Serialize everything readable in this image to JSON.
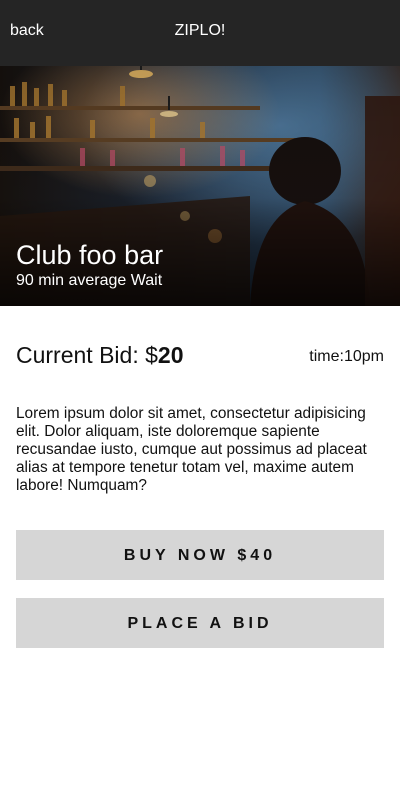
{
  "header": {
    "back_label": "back",
    "title": "ZIPLO!"
  },
  "venue": {
    "name": "Club foo bar",
    "wait": "90 min average Wait",
    "image": "bar-interior-photo"
  },
  "bid": {
    "label_prefix": "Current Bid: $",
    "amount": "20",
    "time": "time:10pm"
  },
  "description": "Lorem ipsum dolor sit amet, consectetur adipisicing elit. Dolor aliquam, iste doloremque sapiente recusandae iusto, cumque aut possimus ad placeat alias at tempore tenetur totam vel, maxime autem labore! Numquam?",
  "actions": {
    "buy_now_label": "BUY NOW $40",
    "place_bid_label": "PLACE A BID"
  },
  "colors": {
    "header_bg": "#252525",
    "button_bg": "#d6d6d6"
  }
}
